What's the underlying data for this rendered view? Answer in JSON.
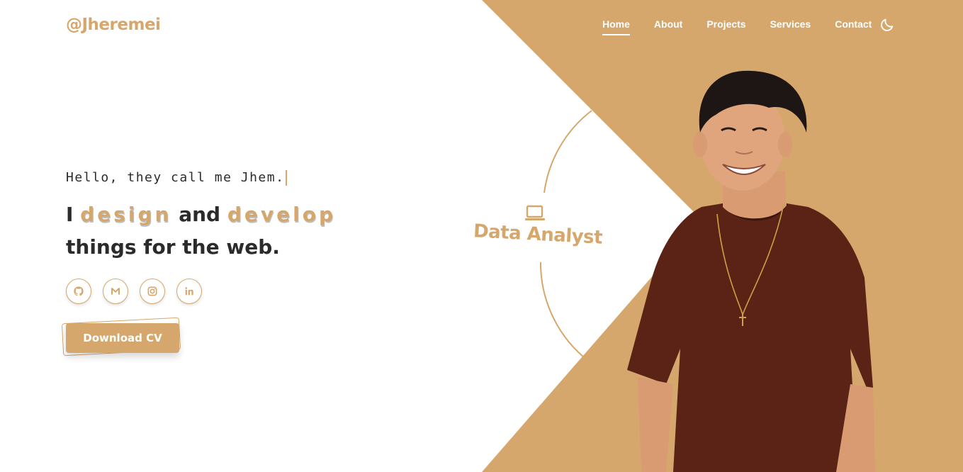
{
  "brand": {
    "logo": "@Jheremei"
  },
  "nav": {
    "items": [
      {
        "label": "Home",
        "active": true
      },
      {
        "label": "About",
        "active": false
      },
      {
        "label": "Projects",
        "active": false
      },
      {
        "label": "Services",
        "active": false
      },
      {
        "label": "Contact",
        "active": false
      }
    ],
    "theme_icon": "moon-icon"
  },
  "hero": {
    "greeting": "Hello, they call me Jhem.",
    "line1_prefix": "I",
    "line1_word1": "design",
    "line1_mid": "and",
    "line1_word2": "develop",
    "line2": "things for the web.",
    "role": "Data Analyst",
    "socials": [
      {
        "icon": "github-icon"
      },
      {
        "icon": "gmail-icon"
      },
      {
        "icon": "instagram-icon"
      },
      {
        "icon": "linkedin-icon"
      }
    ],
    "cta_label": "Download CV"
  },
  "colors": {
    "accent": "#d6a76c",
    "text": "#2b2b2b",
    "background": "#ffffff",
    "shirt": "#5a2316"
  }
}
